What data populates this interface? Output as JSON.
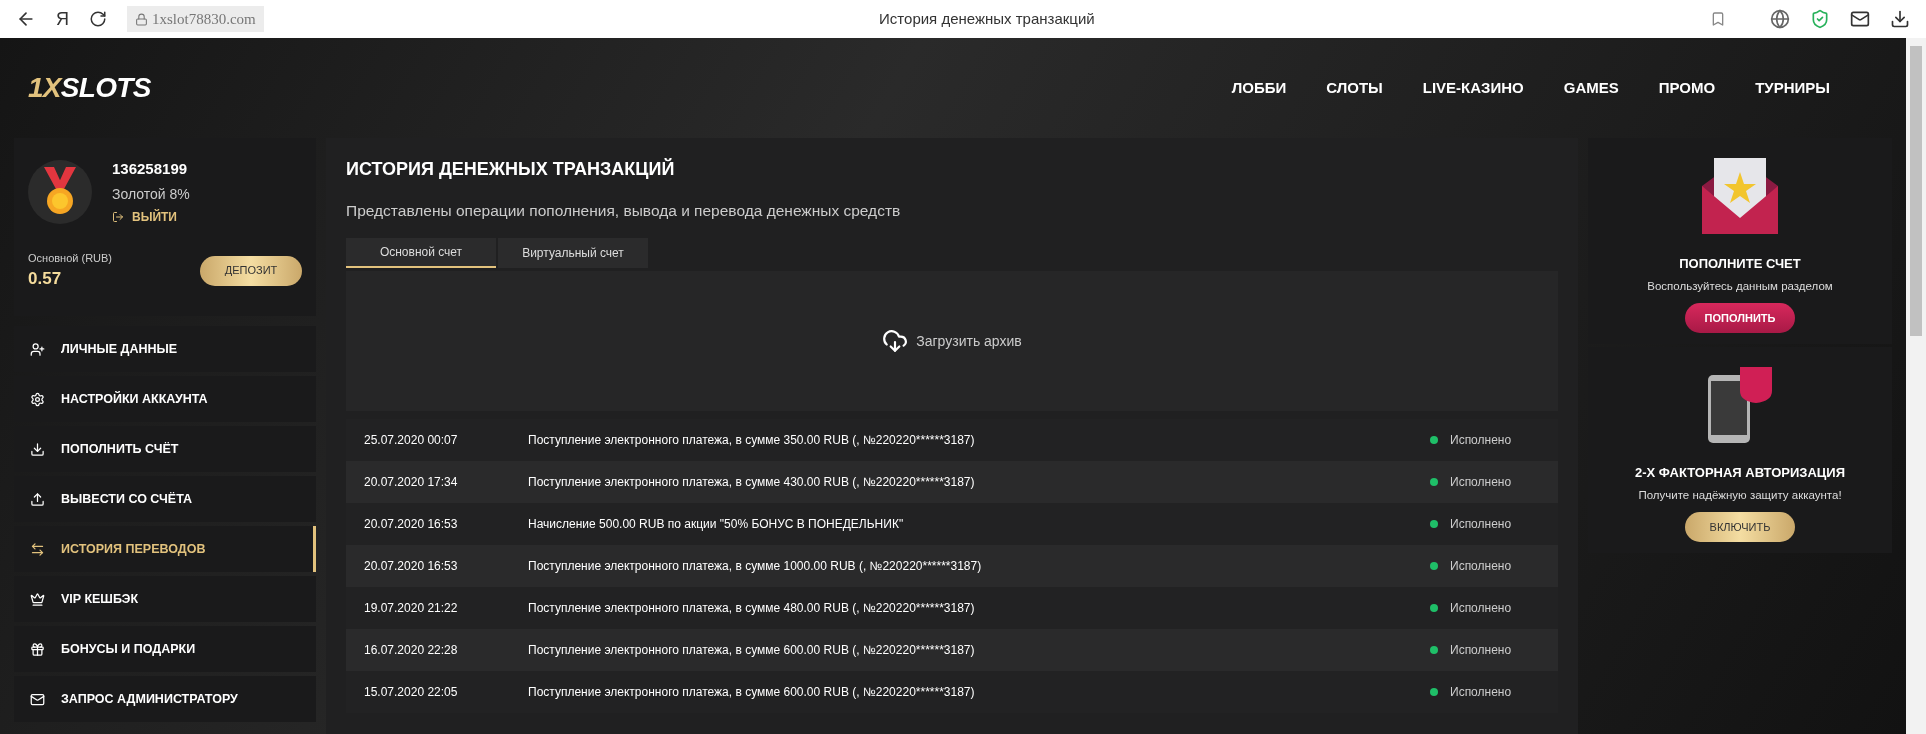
{
  "browser": {
    "url": "1xslot78830.com",
    "title": "История денежных транзакций",
    "nav_glyph": "Я"
  },
  "header": {
    "logo_prefix": "1X",
    "logo": "SLOTS",
    "nav": [
      {
        "label": "ЛОББИ"
      },
      {
        "label": "СЛОТЫ"
      },
      {
        "label": "LIVE-КАЗИНО"
      },
      {
        "label": "GAMES"
      },
      {
        "label": "ПРОМО"
      },
      {
        "label": "ТУРНИРЫ"
      }
    ]
  },
  "profile": {
    "id": "136258199",
    "level": "Золотой 8%",
    "logout": "ВЫЙТИ",
    "balance_label": "Основной (RUB)",
    "balance": "0.57",
    "deposit": "ДЕПОЗИТ"
  },
  "menu": [
    {
      "label": "ЛИЧНЫЕ ДАННЫЕ",
      "kind": "user",
      "selected": false
    },
    {
      "label": "НАСТРОЙКИ АККАУНТА",
      "kind": "gears",
      "selected": false
    },
    {
      "label": "ПОПОЛНИТЬ СЧЁТ",
      "kind": "download",
      "selected": false
    },
    {
      "label": "ВЫВЕСТИ СО СЧЁТА",
      "kind": "upload",
      "selected": false
    },
    {
      "label": "ИСТОРИЯ ПЕРЕВОДОВ",
      "kind": "arrows",
      "selected": true
    },
    {
      "label": "VIP КЕШБЭК",
      "kind": "crown",
      "selected": false
    },
    {
      "label": "БОНУСЫ И ПОДАРКИ",
      "kind": "gift",
      "selected": false
    },
    {
      "label": "ЗАПРОС АДМИНИСТРАТОРУ",
      "kind": "mail",
      "selected": false
    }
  ],
  "main": {
    "title": "ИСТОРИЯ ДЕНЕЖНЫХ ТРАНЗАКЦИЙ",
    "subtitle": "Представлены операции пополнения, вывода и перевода денежных средств",
    "tabs": [
      {
        "label": "Основной счет",
        "selected": true
      },
      {
        "label": "Виртуальный счет",
        "selected": false
      }
    ],
    "archive": "Загрузить архив",
    "rows": [
      {
        "date": "25.07.2020 00:07",
        "description": "Поступление электронного платежа, в сумме 350.00 RUB (, №220220******3187)",
        "status": "Исполнено"
      },
      {
        "date": "20.07.2020 17:34",
        "description": "Поступление электронного платежа, в сумме 430.00 RUB (, №220220******3187)",
        "status": "Исполнено"
      },
      {
        "date": "20.07.2020 16:53",
        "description": "Начисление 500.00 RUB по акции \"50% БОНУС В ПОНЕДЕЛЬНИК\"",
        "status": "Исполнено"
      },
      {
        "date": "20.07.2020 16:53",
        "description": "Поступление электронного платежа, в сумме 1000.00 RUB (, №220220******3187)",
        "status": "Исполнено"
      },
      {
        "date": "19.07.2020 21:22",
        "description": "Поступление электронного платежа, в сумме 480.00 RUB (, №220220******3187)",
        "status": "Исполнено"
      },
      {
        "date": "16.07.2020 22:28",
        "description": "Поступление электронного платежа, в сумме 600.00 RUB (, №220220******3187)",
        "status": "Исполнено"
      },
      {
        "date": "15.07.2020 22:05",
        "description": "Поступление электронного платежа, в сумме 600.00 RUB (, №220220******3187)",
        "status": "Исполнено"
      }
    ]
  },
  "promos": [
    {
      "kind": "envelope",
      "title": "ПОПОЛНИТЕ СЧЕТ",
      "text": "Воспользуйтесь данным разделом",
      "button": "ПОПОЛНИТЬ"
    },
    {
      "kind": "phone",
      "title": "2-Х ФАКТОРНАЯ АВТОРИЗАЦИЯ",
      "text": "Получите надёжную защиту аккаунта!",
      "button": "ВКЛЮЧИТЬ"
    }
  ]
}
